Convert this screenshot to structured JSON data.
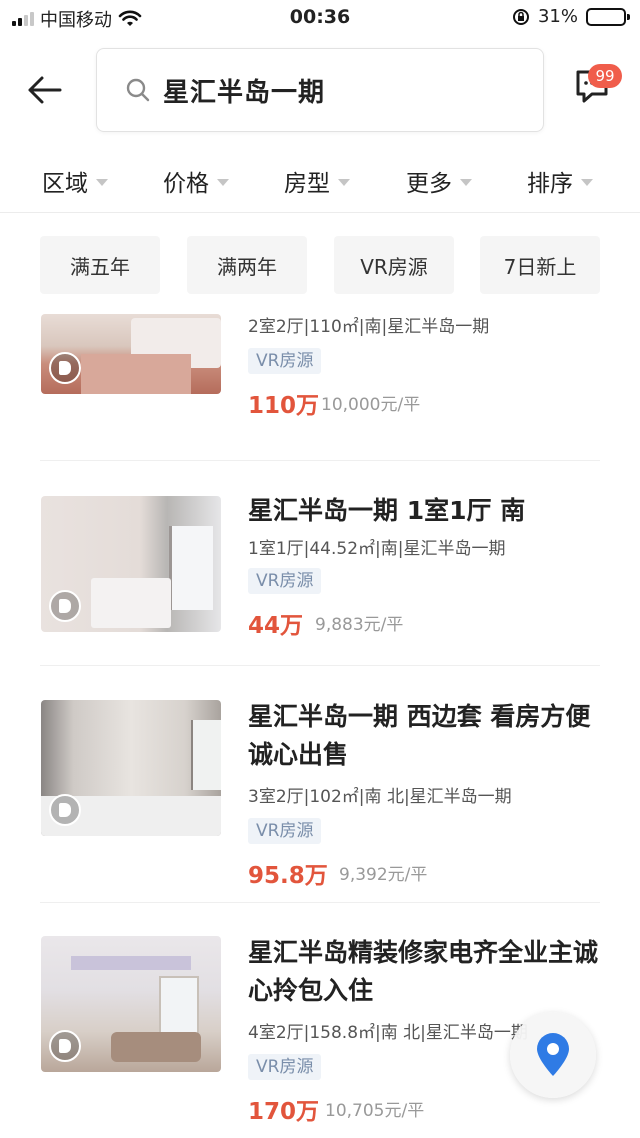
{
  "status_bar": {
    "carrier": "中国移动",
    "time": "00:36",
    "battery": "31%",
    "battery_level": 0.31
  },
  "header": {
    "search_text": "星汇半岛一期",
    "message_badge": "99"
  },
  "filters": [
    "区域",
    "价格",
    "房型",
    "更多",
    "排序"
  ],
  "tags": [
    "满五年",
    "满两年",
    "VR房源",
    "7日新上"
  ],
  "listings": [
    {
      "title": "",
      "meta": "2室2厅|110㎡|南|星汇半岛一期",
      "tag": "VR房源",
      "price": "110万",
      "unit_price": "10,000元/平"
    },
    {
      "title": "星汇半岛一期 1室1厅 南",
      "meta": "1室1厅|44.52㎡|南|星汇半岛一期",
      "tag": "VR房源",
      "price": "44万",
      "unit_price": "9,883元/平"
    },
    {
      "title": "星汇半岛一期 西边套 看房方便 诚心出售",
      "meta": "3室2厅|102㎡|南 北|星汇半岛一期",
      "tag": "VR房源",
      "price": "95.8万",
      "unit_price": "9,392元/平"
    },
    {
      "title": "星汇半岛精装修家电齐全业主诚心拎包入住",
      "meta": "4室2厅|158.8㎡|南 北|星汇半岛一期",
      "tag": "VR房源",
      "price": "170万",
      "unit_price": "10,705元/平"
    }
  ],
  "colors": {
    "price": "#e2553c",
    "badge": "#f05d4b",
    "vr_tag_bg": "#eff3f8",
    "map_pin": "#2f7be5"
  },
  "icons": [
    "back-arrow-icon",
    "search-icon",
    "message-icon",
    "dropdown-triangle-icon",
    "vr-icon",
    "map-pin-icon",
    "wifi-icon",
    "battery-icon"
  ]
}
